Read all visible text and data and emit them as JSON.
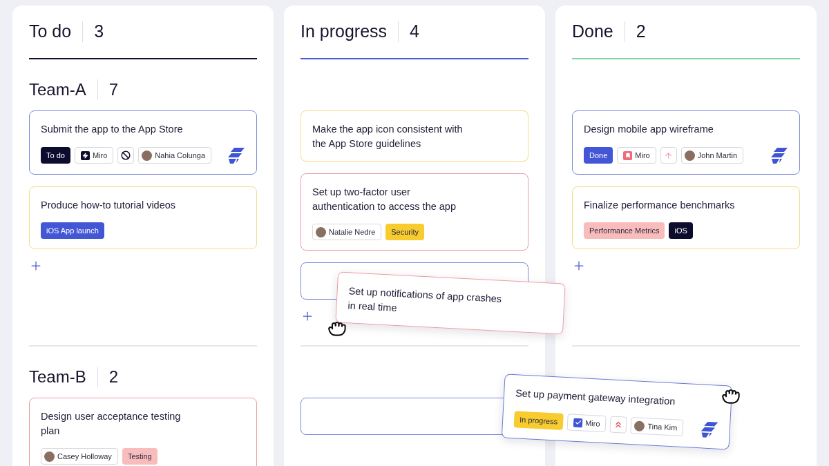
{
  "columns": [
    {
      "title": "To do",
      "count": "3",
      "color": "#14132b"
    },
    {
      "title": "In progress",
      "count": "4",
      "color": "#4a5bd0"
    },
    {
      "title": "Done",
      "count": "2",
      "color": "#7fd3a4"
    }
  ],
  "lanes": [
    {
      "name": "Team-A",
      "count": "7",
      "cells": [
        {
          "add_button": true,
          "cards": [
            {
              "kind": "card",
              "title": "Submit the app to the App Store",
              "color": "#7b88d8",
              "logo": true,
              "tags": [
                {
                  "kind": "status",
                  "text": "To do",
                  "color": "#0d0b2e"
                },
                {
                  "kind": "bolt",
                  "text": "Miro"
                },
                {
                  "kind": "blocked"
                },
                {
                  "kind": "person",
                  "text": "Nahia Colunga"
                }
              ]
            },
            {
              "kind": "card",
              "title": "Produce how-to tutorial videos",
              "color": "#f3dc84",
              "tags": [
                {
                  "kind": "label",
                  "text": "iOS App launch",
                  "color": "#4356d6"
                }
              ]
            }
          ]
        },
        {
          "add_button": true,
          "cards": [
            {
              "kind": "card",
              "title": "Make the app icon consistent with the App Store guidelines",
              "color": "#f3dc84"
            },
            {
              "kind": "card",
              "title": "Set up two-factor user authentication to access the app",
              "color": "#ec9ca2",
              "tags": [
                {
                  "kind": "person",
                  "text": "Natalie Nedre"
                },
                {
                  "kind": "label",
                  "text": "Security",
                  "color": "#f8cc2e"
                }
              ]
            },
            {
              "kind": "placeholder",
              "color": "#7b88d8"
            }
          ]
        },
        {
          "add_button": true,
          "cards": [
            {
              "kind": "card",
              "title": "Design mobile app wireframe",
              "color": "#7b88d8",
              "logo": true,
              "tags": [
                {
                  "kind": "status",
                  "text": "Done",
                  "color": "#4356d6"
                },
                {
                  "kind": "bookmark",
                  "text": "Miro"
                },
                {
                  "kind": "arrow"
                },
                {
                  "kind": "person",
                  "text": "John Martin"
                }
              ]
            },
            {
              "kind": "card",
              "title": "Finalize performance benchmarks",
              "color": "#f3dc84",
              "tags": [
                {
                  "kind": "label",
                  "text": "Performance Metrics",
                  "color": "#f9bcbc"
                },
                {
                  "kind": "label",
                  "text": "iOS",
                  "color": "#0d0b2e"
                }
              ]
            }
          ]
        }
      ]
    },
    {
      "name": "Team-B",
      "count": "2",
      "cells": [
        {
          "cards": [
            {
              "kind": "card",
              "title": "Design user acceptance testing plan",
              "color": "#ec9ca2",
              "tags": [
                {
                  "kind": "person",
                  "text": "Casey Holloway"
                },
                {
                  "kind": "label",
                  "text": "Testing",
                  "color": "#f9bcbc"
                }
              ]
            }
          ]
        },
        {
          "cards": [
            {
              "kind": "placeholder",
              "color": "#7b88d8"
            }
          ]
        },
        {}
      ]
    }
  ],
  "dragged_cards": [
    {
      "kind": "card",
      "title": "Set up notifications of app crashes in real time",
      "color": "#ec9ca2"
    },
    {
      "kind": "card",
      "title": "Set up payment gateway integration",
      "color": "#6b79d6",
      "logo": true,
      "tags": [
        {
          "kind": "status",
          "text": "In progress",
          "color": "#f8cc2e"
        },
        {
          "kind": "checkbox",
          "text": "Miro"
        },
        {
          "kind": "chevrons"
        },
        {
          "kind": "person",
          "text": "Tina Kim"
        }
      ]
    }
  ]
}
